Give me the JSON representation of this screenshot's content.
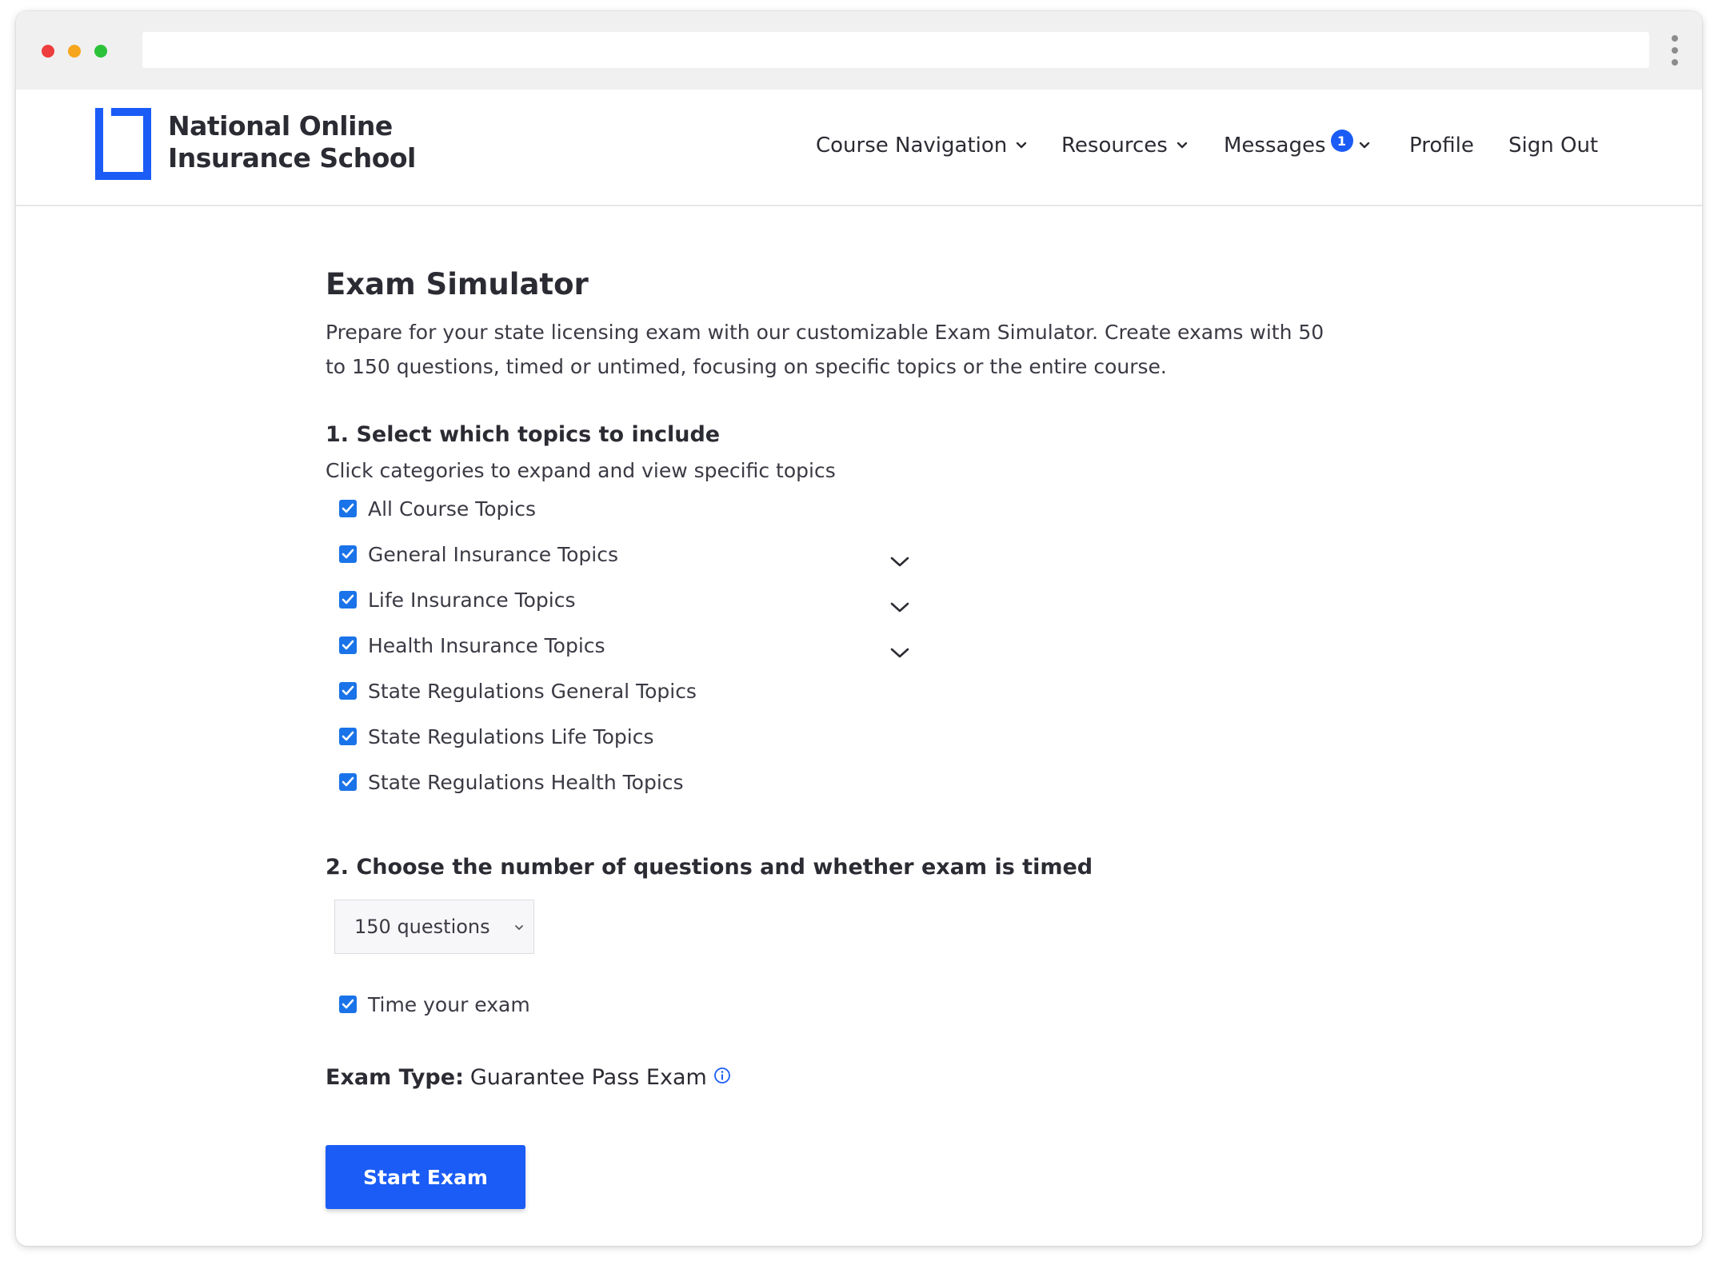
{
  "browser": {
    "address_value": "",
    "traffic_lights": [
      "close",
      "minimize",
      "maximize"
    ],
    "menu_icon": "kebab-menu-icon"
  },
  "site": {
    "logo_line1": "National Online",
    "logo_line2": "Insurance School",
    "brand_color": "#1a5cf5"
  },
  "nav": {
    "course_navigation": "Course Navigation",
    "resources": "Resources",
    "messages": "Messages",
    "messages_badge": "1",
    "profile": "Profile",
    "sign_out": "Sign Out"
  },
  "main": {
    "title": "Exam Simulator",
    "intro_line1": "Prepare for your state licensing exam with our customizable Exam Simulator. Create exams with 50",
    "intro_line2": "to 150 questions, timed or untimed, focusing on specific topics or the entire course.",
    "section1_title": "1. Select which topics to include",
    "section1_hint": "Click categories to expand and view specific topics",
    "topics": [
      {
        "label": "All Course Topics",
        "checked": true,
        "expandable": false
      },
      {
        "label": "General Insurance Topics",
        "checked": true,
        "expandable": true
      },
      {
        "label": "Life Insurance Topics",
        "checked": true,
        "expandable": true
      },
      {
        "label": "Health Insurance Topics",
        "checked": true,
        "expandable": true
      },
      {
        "label": "State Regulations General Topics",
        "checked": true,
        "expandable": false
      },
      {
        "label": "State Regulations Life Topics",
        "checked": true,
        "expandable": false
      },
      {
        "label": "State Regulations Health Topics",
        "checked": true,
        "expandable": false
      }
    ],
    "section2_title": "2. Choose the number of questions and whether exam is timed",
    "question_count": "150 questions",
    "timed_label": "Time your exam",
    "timed_checked": true,
    "exam_type_label": "Exam Type:",
    "exam_type_value": "Guarantee Pass Exam",
    "start_button": "Start Exam"
  }
}
